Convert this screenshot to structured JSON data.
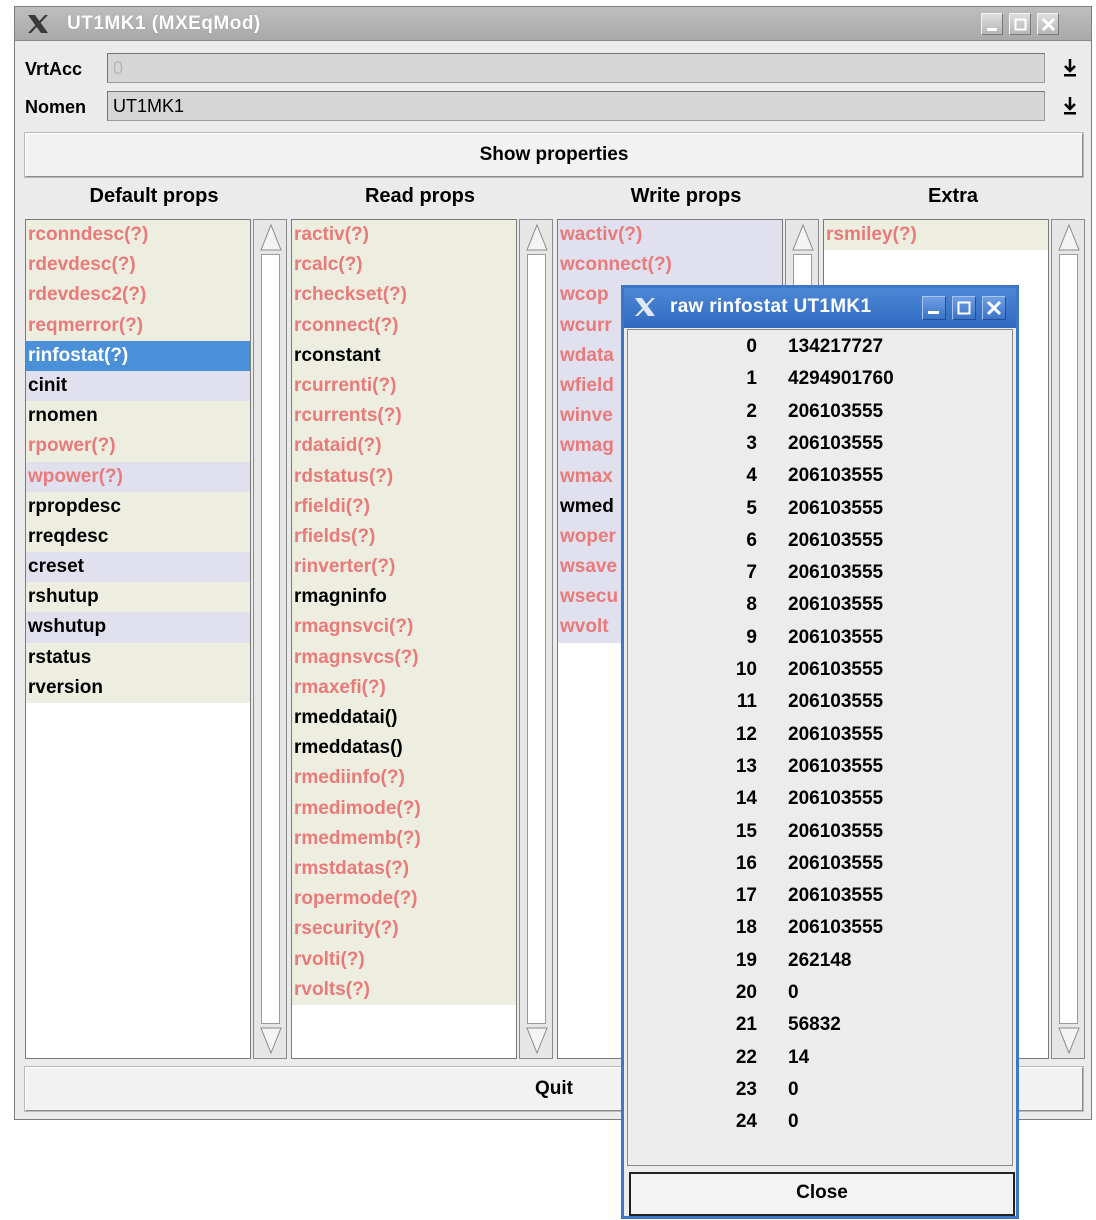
{
  "window": {
    "title": "UT1MK1 (MXEqMod)"
  },
  "fields": {
    "vrtacc_label": "VrtAcc",
    "vrtacc_value": "0",
    "nomen_label": "Nomen",
    "nomen_value": "UT1MK1"
  },
  "show_properties_label": "Show properties",
  "quit_label": "Quit",
  "columns": {
    "default": {
      "header": "Default props",
      "items": [
        {
          "label": "rconndesc(?)",
          "kind": "r",
          "state": "unk"
        },
        {
          "label": "rdevdesc(?)",
          "kind": "r",
          "state": "unk"
        },
        {
          "label": "rdevdesc2(?)",
          "kind": "r",
          "state": "unk"
        },
        {
          "label": "reqmerror(?)",
          "kind": "r",
          "state": "unk"
        },
        {
          "label": "rinfostat(?)",
          "kind": "r",
          "state": "sel"
        },
        {
          "label": "cinit",
          "kind": "w",
          "state": "ok"
        },
        {
          "label": "rnomen",
          "kind": "r",
          "state": "ok"
        },
        {
          "label": "rpower(?)",
          "kind": "r",
          "state": "unk"
        },
        {
          "label": "wpower(?)",
          "kind": "w",
          "state": "unk"
        },
        {
          "label": "rpropdesc",
          "kind": "r",
          "state": "ok"
        },
        {
          "label": "rreqdesc",
          "kind": "r",
          "state": "ok"
        },
        {
          "label": "creset",
          "kind": "w",
          "state": "ok"
        },
        {
          "label": "rshutup",
          "kind": "r",
          "state": "ok"
        },
        {
          "label": "wshutup",
          "kind": "w",
          "state": "ok"
        },
        {
          "label": "rstatus",
          "kind": "r",
          "state": "ok"
        },
        {
          "label": "rversion",
          "kind": "r",
          "state": "ok"
        }
      ]
    },
    "read": {
      "header": "Read props",
      "items": [
        {
          "label": "ractiv(?)",
          "kind": "r",
          "state": "unk"
        },
        {
          "label": "rcalc(?)",
          "kind": "r",
          "state": "unk"
        },
        {
          "label": "rcheckset(?)",
          "kind": "r",
          "state": "unk"
        },
        {
          "label": "rconnect(?)",
          "kind": "r",
          "state": "unk"
        },
        {
          "label": "rconstant",
          "kind": "r",
          "state": "ok"
        },
        {
          "label": "rcurrenti(?)",
          "kind": "r",
          "state": "unk"
        },
        {
          "label": "rcurrents(?)",
          "kind": "r",
          "state": "unk"
        },
        {
          "label": "rdataid(?)",
          "kind": "r",
          "state": "unk"
        },
        {
          "label": "rdstatus(?)",
          "kind": "r",
          "state": "unk"
        },
        {
          "label": "rfieldi(?)",
          "kind": "r",
          "state": "unk"
        },
        {
          "label": "rfields(?)",
          "kind": "r",
          "state": "unk"
        },
        {
          "label": "rinverter(?)",
          "kind": "r",
          "state": "unk"
        },
        {
          "label": "rmagninfo",
          "kind": "r",
          "state": "ok"
        },
        {
          "label": "rmagnsvci(?)",
          "kind": "r",
          "state": "unk"
        },
        {
          "label": "rmagnsvcs(?)",
          "kind": "r",
          "state": "unk"
        },
        {
          "label": "rmaxefi(?)",
          "kind": "r",
          "state": "unk"
        },
        {
          "label": "rmeddatai()",
          "kind": "r",
          "state": "ok"
        },
        {
          "label": "rmeddatas()",
          "kind": "r",
          "state": "ok"
        },
        {
          "label": "rmediinfo(?)",
          "kind": "r",
          "state": "unk"
        },
        {
          "label": "rmedimode(?)",
          "kind": "r",
          "state": "unk"
        },
        {
          "label": "rmedmemb(?)",
          "kind": "r",
          "state": "unk"
        },
        {
          "label": "rmstdatas(?)",
          "kind": "r",
          "state": "unk"
        },
        {
          "label": "ropermode(?)",
          "kind": "r",
          "state": "unk"
        },
        {
          "label": "rsecurity(?)",
          "kind": "r",
          "state": "unk"
        },
        {
          "label": "rvolti(?)",
          "kind": "r",
          "state": "unk"
        },
        {
          "label": "rvolts(?)",
          "kind": "r",
          "state": "unk"
        }
      ]
    },
    "write": {
      "header": "Write props",
      "items": [
        {
          "label": "wactiv(?)",
          "kind": "w",
          "state": "unk"
        },
        {
          "label": "wconnect(?)",
          "kind": "w",
          "state": "unk"
        },
        {
          "label": "wcop",
          "kind": "w",
          "state": "unk"
        },
        {
          "label": "wcurr",
          "kind": "w",
          "state": "unk"
        },
        {
          "label": "wdata",
          "kind": "w",
          "state": "unk"
        },
        {
          "label": "wfield",
          "kind": "w",
          "state": "unk"
        },
        {
          "label": "winve",
          "kind": "w",
          "state": "unk"
        },
        {
          "label": "wmag",
          "kind": "w",
          "state": "unk"
        },
        {
          "label": "wmax",
          "kind": "w",
          "state": "unk"
        },
        {
          "label": "wmed",
          "kind": "w",
          "state": "ok"
        },
        {
          "label": "woper",
          "kind": "w",
          "state": "unk"
        },
        {
          "label": "wsave",
          "kind": "w",
          "state": "unk"
        },
        {
          "label": "wsecu",
          "kind": "w",
          "state": "unk"
        },
        {
          "label": "wvolt",
          "kind": "w",
          "state": "unk"
        }
      ]
    },
    "extra": {
      "header": "Extra",
      "items": [
        {
          "label": "rsmiley(?)",
          "kind": "r",
          "state": "unk"
        }
      ]
    }
  },
  "popup": {
    "title": "raw rinfostat UT1MK1",
    "close_label": "Close",
    "rows": [
      {
        "idx": "0",
        "val": "134217727"
      },
      {
        "idx": "1",
        "val": "4294901760"
      },
      {
        "idx": "2",
        "val": "206103555"
      },
      {
        "idx": "3",
        "val": "206103555"
      },
      {
        "idx": "4",
        "val": "206103555"
      },
      {
        "idx": "5",
        "val": "206103555"
      },
      {
        "idx": "6",
        "val": "206103555"
      },
      {
        "idx": "7",
        "val": "206103555"
      },
      {
        "idx": "8",
        "val": "206103555"
      },
      {
        "idx": "9",
        "val": "206103555"
      },
      {
        "idx": "10",
        "val": "206103555"
      },
      {
        "idx": "11",
        "val": "206103555"
      },
      {
        "idx": "12",
        "val": "206103555"
      },
      {
        "idx": "13",
        "val": "206103555"
      },
      {
        "idx": "14",
        "val": "206103555"
      },
      {
        "idx": "15",
        "val": "206103555"
      },
      {
        "idx": "16",
        "val": "206103555"
      },
      {
        "idx": "17",
        "val": "206103555"
      },
      {
        "idx": "18",
        "val": "206103555"
      },
      {
        "idx": "19",
        "val": "262148"
      },
      {
        "idx": "20",
        "val": "0"
      },
      {
        "idx": "21",
        "val": "56832"
      },
      {
        "idx": "22",
        "val": "14"
      },
      {
        "idx": "23",
        "val": "0"
      },
      {
        "idx": "24",
        "val": "0"
      }
    ]
  },
  "colors": {
    "unknown_text": "#e97a7a",
    "read_row_bg": "#eeeee0",
    "write_row_bg": "#e0e0ee",
    "selection": "#4a90d9",
    "popup_title": "#3d77c8"
  },
  "icons": {
    "window_menu": "x-logo-icon",
    "minimize": "minimize-icon",
    "maximize": "maximize-icon",
    "close": "close-icon",
    "download": "download-arrow-icon",
    "scroll_up": "scroll-up-arrow-icon",
    "scroll_down": "scroll-down-arrow-icon"
  }
}
